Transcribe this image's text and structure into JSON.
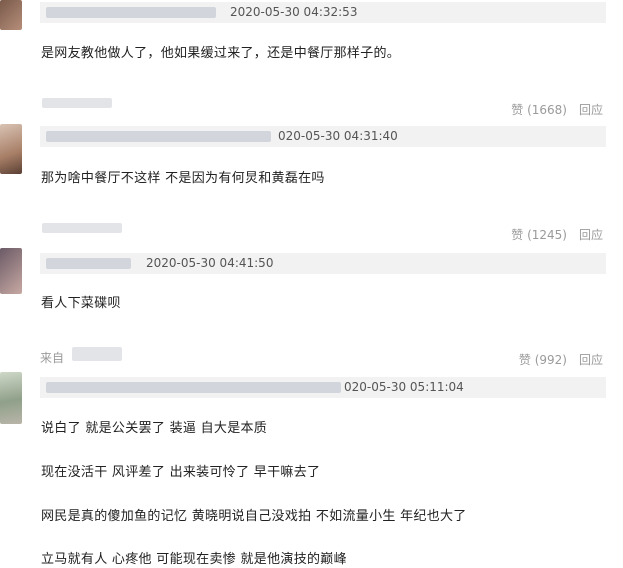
{
  "comments": [
    {
      "timestamp": "2020-05-30 04:32:53",
      "text": "是网友教他做人了，他如果缓过来了，还是中餐厅那样子的。",
      "likes": "赞 (1668)",
      "reply": "回应"
    },
    {
      "timestamp": "020-05-30 04:31:40",
      "text": "那为啥中餐厅不这样 不是因为有何炅和黄磊在吗",
      "likes": "赞 (1245)",
      "reply": "回应"
    },
    {
      "timestamp": "2020-05-30 04:41:50",
      "text": "看人下菜碟呗",
      "likes": "赞 (992)",
      "reply": "回应",
      "from_label": "来自"
    },
    {
      "timestamp": "020-05-30 05:11:04",
      "lines": [
        "说白了 就是公关罢了 装逼 自大是本质",
        "现在没活干 风评差了 出来装可怜了 早干嘛去了",
        "网民是真的傻加鱼的记忆 黄晓明说自己没戏拍 不如流量小生 年纪也大了",
        "立马就有人 心疼他 可能现在卖惨 就是他演技的巅峰"
      ]
    }
  ],
  "colors": {
    "bar_background": "#f2f2f2",
    "action_text": "#9a9a9a",
    "content_text": "#222222"
  }
}
